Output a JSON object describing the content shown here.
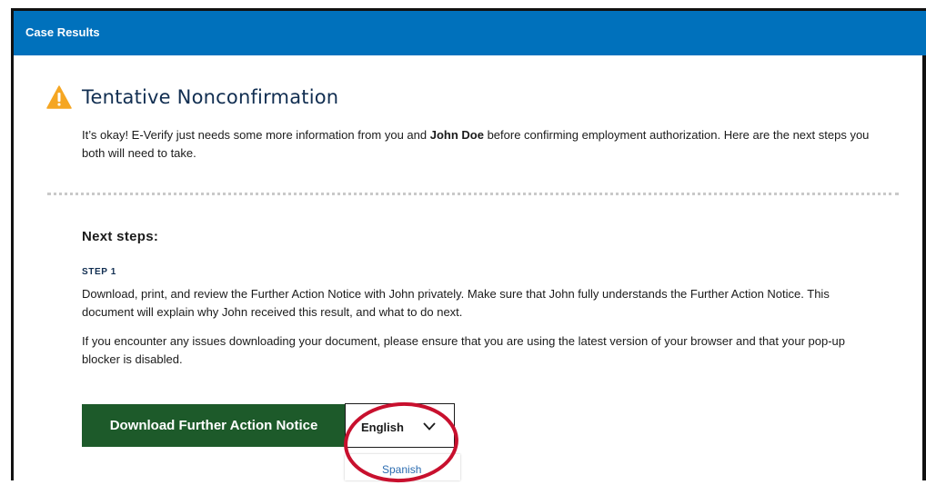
{
  "header": {
    "title": "Case Results"
  },
  "alert": {
    "icon": "warning-icon",
    "title": "Tentative Nonconfirmation",
    "body_prefix": "It’s okay! E-Verify just needs some more information from you and ",
    "employee_name": "John Doe",
    "body_suffix": " before confirming employment authorization. Here are the next steps you both will need to take."
  },
  "next_steps": {
    "heading": "Next steps:",
    "step1_label": "STEP 1",
    "step1_text": "Download, print, and review the Further Action Notice with John privately. Make sure that John fully understands the Further Action Notice. This document will explain why John received this result, and what to do next.",
    "issue_text": "If you encounter any issues downloading your document, please ensure that you are using the latest version of your browser and that your pop-up blocker is disabled."
  },
  "download": {
    "button_label": "Download Further Action Notice",
    "language_selected": "English",
    "language_options": [
      "Spanish"
    ]
  },
  "colors": {
    "header_bg": "#0071bc",
    "button_bg": "#1d5a2a",
    "warning": "#f5a623",
    "annotation_circle": "#c8102e"
  }
}
